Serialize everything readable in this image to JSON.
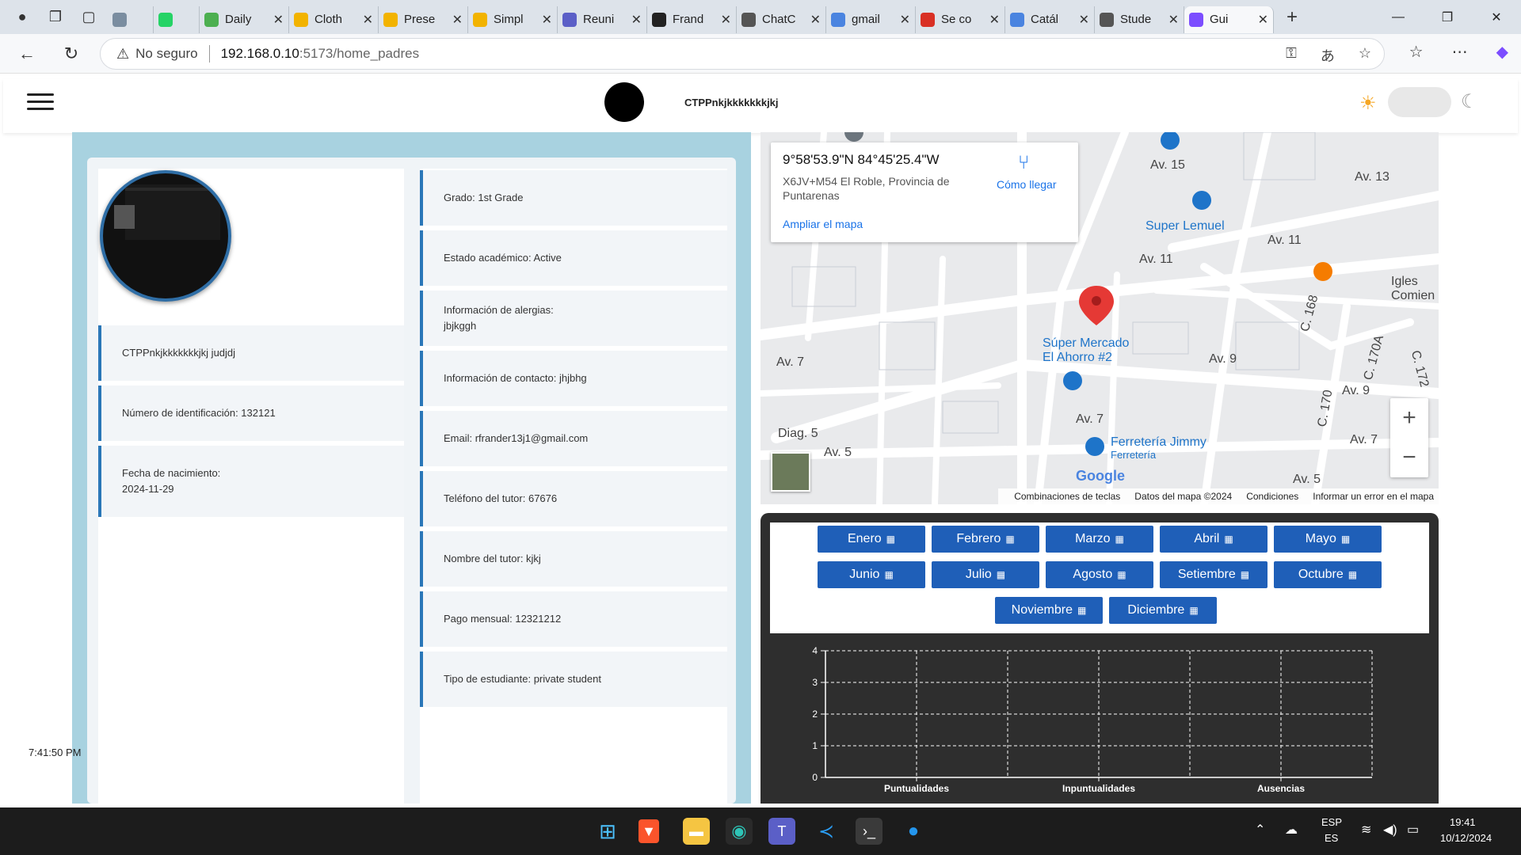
{
  "browser": {
    "tabs": [
      {
        "label": "",
        "color": "#7a8da0"
      },
      {
        "label": "",
        "color": "#25d366"
      },
      {
        "label": "Daily",
        "color": "#4caf50"
      },
      {
        "label": "Cloth",
        "color": "#f2b300"
      },
      {
        "label": "Prese",
        "color": "#f2b300"
      },
      {
        "label": "Simpl",
        "color": "#f2b300"
      },
      {
        "label": "Reuni",
        "color": "#5b5fc7"
      },
      {
        "label": "Frand",
        "color": "#222222"
      },
      {
        "label": "ChatC",
        "color": "#555555"
      },
      {
        "label": "gmail",
        "color": "#4a84e0"
      },
      {
        "label": "Se co",
        "color": "#d93025"
      },
      {
        "label": "Catál",
        "color": "#4a84e0"
      },
      {
        "label": "Stude",
        "color": "#555555"
      },
      {
        "label": "Gui",
        "color": "#7c4dff"
      }
    ],
    "insecure_label": "No seguro",
    "url_host": "192.168.0.10",
    "url_path": ":5173/home_padres"
  },
  "header": {
    "school_name": "CTPPnkjkkkkkkkjkj"
  },
  "profile": {
    "left_items": [
      "CTPPnkjkkkkkkkjkj judjdj",
      "Número de identificación: 132121",
      "Fecha de nacimiento:\n2024-11-29"
    ],
    "right_items": [
      "Grado: 1st Grade",
      "Estado académico: Active",
      "Información de alergias:\njbjkggh",
      "Información de contacto: jhjbhg",
      "Email: rfrander13j1@gmail.com",
      "Teléfono del tutor: 67676",
      "Nombre del tutor: kjkj",
      "Pago mensual: 12321212",
      "Tipo de estudiante: private student"
    ],
    "clock": "7:41:50 PM"
  },
  "map": {
    "coords": "9°58'53.9\"N 84°45'25.4\"W",
    "address": "X6JV+M54 El Roble, Provincia de Puntarenas",
    "directions": "Cómo llegar",
    "enlarge": "Ampliar el mapa",
    "labels": {
      "av15": "Av. 15",
      "av13": "Av. 13",
      "super_lemuel": "Super Lemuel",
      "av11a": "Av. 11",
      "av11b": "Av. 11",
      "iglesia": "Igles\nComien",
      "super_ahorro": "Súper Mercado\nEl Ahorro #2",
      "av9a": "Av. 9",
      "av9b": "Av. 9",
      "av7a": "Av. 7",
      "av7b": "Av. 7",
      "av7c": "Av. 7",
      "diag5": "Diag. 5",
      "av5a": "Av. 5",
      "av5b": "Av. 5",
      "c168": "C. 168",
      "c170a": "C. 170A",
      "c172": "C. 172",
      "c170": "C. 170",
      "ferreteria": "Ferretería Jimmy",
      "ferreteria_sub": "Ferretería"
    },
    "google": "Google",
    "footer": [
      "Combinaciones de teclas",
      "Datos del mapa ©2024",
      "Condiciones",
      "Informar un error en el mapa"
    ]
  },
  "attendance": {
    "months": [
      "Enero",
      "Febrero",
      "Marzo",
      "Abril",
      "Mayo",
      "Junio",
      "Julio",
      "Agosto",
      "Setiembre",
      "Octubre",
      "Noviembre",
      "Diciembre"
    ]
  },
  "chart_data": {
    "type": "bar",
    "categories": [
      "Puntualidades",
      "Inpuntualidades",
      "Ausencias"
    ],
    "values": [
      0,
      0,
      0
    ],
    "ylim": [
      0,
      4
    ],
    "yticks": [
      "0",
      "1",
      "2",
      "3",
      "4"
    ],
    "grid": true,
    "title": "",
    "xlabel": "",
    "ylabel": ""
  },
  "taskbar": {
    "lang_top": "ESP",
    "lang_bottom": "ES",
    "time": "19:41",
    "date": "10/12/2024"
  }
}
